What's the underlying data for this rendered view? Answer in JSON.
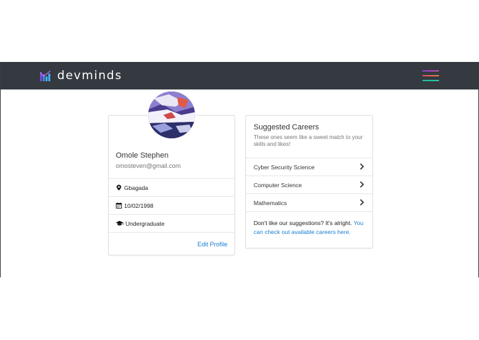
{
  "brand": {
    "name": "devminds",
    "logo_icon": "devminds-logo-icon"
  },
  "navbar": {
    "menu_icon": "hamburger-menu-icon",
    "colors": {
      "background": "#343a40"
    }
  },
  "profile": {
    "name": "Omole Stephen",
    "email": "omosteven@gmail.com",
    "location": "Gbagada",
    "birth_date": "10/02/1998",
    "education": "Undergraduate",
    "edit_label": "Edit Profile"
  },
  "careers": {
    "title": "Suggested Careers",
    "subtitle": "These ones seem like a sweet match to your skills and likes!",
    "items": [
      {
        "label": "Cyber Security Science"
      },
      {
        "label": "Computer Science"
      },
      {
        "label": "Mathematics"
      }
    ],
    "footer_text": "Don't like our suggestions? It's alright. ",
    "footer_link": "You can check out available careers here."
  },
  "colors": {
    "accent_link": "#1a7fd0",
    "card_border": "#dfe1e4"
  }
}
